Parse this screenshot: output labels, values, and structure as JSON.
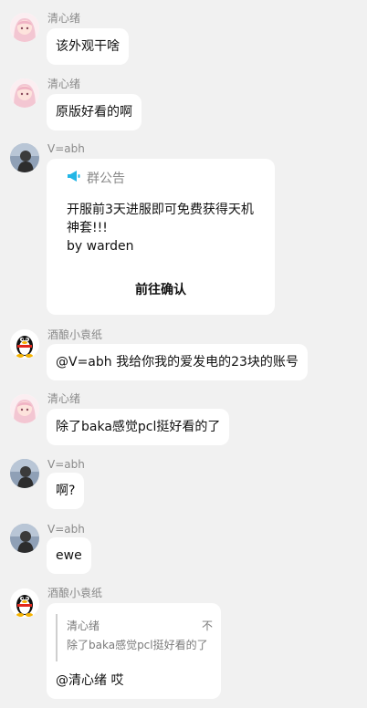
{
  "users": {
    "qingxinxu": "清心绪",
    "vabh": "V=abh",
    "jiuniang": "酒酿小袁纸"
  },
  "messages": [
    {
      "sender": "清心绪",
      "text": "该外观干啥"
    },
    {
      "sender": "清心绪",
      "text": "原版好看的啊"
    },
    {
      "sender": "V=abh",
      "announcement": {
        "title": "群公告",
        "line1": "开服前3天进服即可免费获得天机",
        "line2": "神套!!!",
        "line3": "by  warden",
        "confirm": "前往确认"
      }
    },
    {
      "sender": "酒酿小袁纸",
      "text": "@V=abh 我给你我的爱发电的23块的账号"
    },
    {
      "sender": "清心绪",
      "text": "除了baka感觉pcl挺好看的了"
    },
    {
      "sender": "V=abh",
      "text": "啊?"
    },
    {
      "sender": "V=abh",
      "text": "ewe"
    },
    {
      "sender": "酒酿小袁纸",
      "reply": {
        "quoted_name": "清心绪",
        "close": "不",
        "quoted_text": "除了baka感觉pcl挺好看的了",
        "text": "@清心绪  哎"
      }
    }
  ],
  "colors": {
    "background": "#f1f1f1",
    "bubble": "#ffffff",
    "name": "#8a8a8a",
    "announce_icon": "#22b6e6"
  }
}
